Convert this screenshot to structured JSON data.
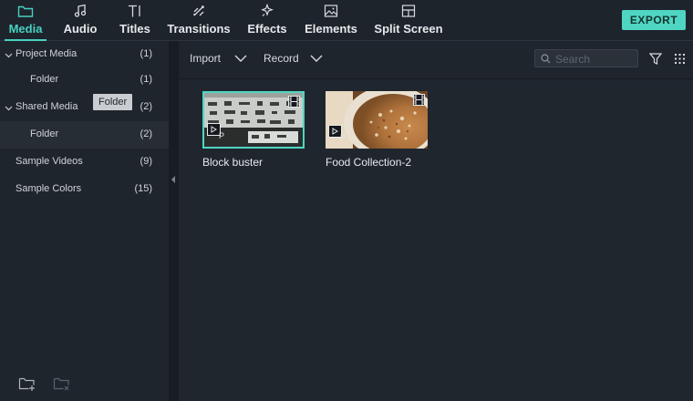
{
  "tabs": [
    {
      "label": "Media",
      "icon": "folder-icon",
      "active": true
    },
    {
      "label": "Audio",
      "icon": "music-note-icon"
    },
    {
      "label": "Titles",
      "icon": "text-cursor-icon"
    },
    {
      "label": "Transitions",
      "icon": "transitions-icon"
    },
    {
      "label": "Effects",
      "icon": "sparkle-icon"
    },
    {
      "label": "Elements",
      "icon": "image-icon"
    },
    {
      "label": "Split Screen",
      "icon": "split-screen-icon"
    }
  ],
  "export_label": "EXPORT",
  "tree": [
    {
      "label": "Project Media",
      "count": "(1)",
      "expanded": true
    },
    {
      "label": "Folder",
      "count": "(1)"
    },
    {
      "label": "Shared Media",
      "count": "(2)",
      "expanded": true
    },
    {
      "label": "Folder",
      "count": "(2)",
      "selected": true
    },
    {
      "label": "Sample Videos",
      "count": "(9)"
    },
    {
      "label": "Sample Colors",
      "count": "(15)"
    }
  ],
  "tooltip": "Folder",
  "toolbar": {
    "import_label": "Import",
    "record_label": "Record",
    "search_placeholder": "Search"
  },
  "media": [
    {
      "title": "Block buster",
      "selected": true
    },
    {
      "title": "Food Collection-2"
    }
  ],
  "colors": {
    "accent": "#4fd6c3",
    "background": "#1f252d"
  }
}
